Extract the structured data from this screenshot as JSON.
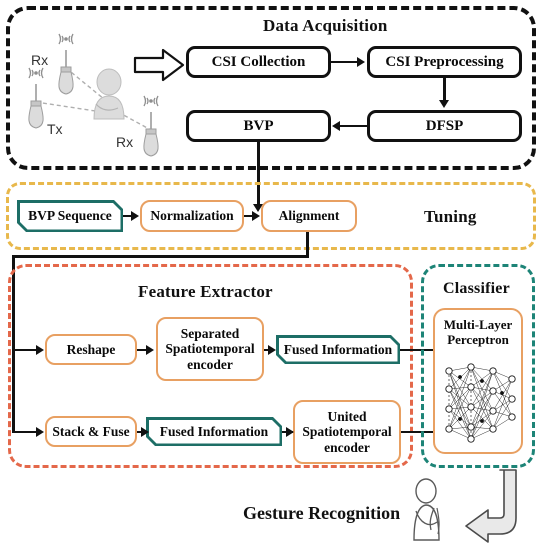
{
  "figure": {
    "caption": "Gesture Recognition",
    "groups": {
      "acquisition": {
        "title": "Data Acquisition",
        "border_color": "#111111",
        "style": "dashed"
      },
      "tuning": {
        "title": "Tuning",
        "border_color": "#E8B84B",
        "style": "dashed"
      },
      "feature": {
        "title": "Feature Extractor",
        "border_color": "#E4684A",
        "style": "dashed"
      },
      "classifier": {
        "title": "Classifier",
        "border_color": "#1D8477",
        "style": "dashed"
      }
    }
  },
  "scene": {
    "labels": {
      "rx_top": "Rx",
      "tx": "Tx",
      "rx_bottom": "Rx"
    },
    "icons": {
      "antenna": "antenna-icon",
      "person": "person-icon",
      "block_arrow": "block-arrow-right-icon"
    }
  },
  "acquisition": {
    "nodes": [
      {
        "id": "csi-collection",
        "label": "CSI Collection"
      },
      {
        "id": "csi-preprocessing",
        "label": "CSI Preprocessing"
      },
      {
        "id": "dfsp",
        "label": "DFSP"
      },
      {
        "id": "bvp",
        "label": "BVP"
      }
    ]
  },
  "tuning": {
    "nodes": [
      {
        "id": "bvp-sequence",
        "label": "BVP Sequence",
        "color": "#1D6E66"
      },
      {
        "id": "normalization",
        "label": "Normalization",
        "color": "#E8A062"
      },
      {
        "id": "alignment",
        "label": "Alignment",
        "color": "#E8A062"
      }
    ]
  },
  "feature_extractor": {
    "nodes": [
      {
        "id": "reshape",
        "label": "Reshape",
        "color": "#E8A062"
      },
      {
        "id": "separated-encoder",
        "label": "Separated Spatiotemporal encoder",
        "color": "#E8A062"
      },
      {
        "id": "fused-information-top",
        "label": "Fused Information",
        "color": "#1D6E66"
      },
      {
        "id": "stack-and-fuse",
        "label": "Stack & Fuse",
        "color": "#E8A062"
      },
      {
        "id": "fused-information-bottom",
        "label": "Fused Information",
        "color": "#1D6E66"
      },
      {
        "id": "united-encoder",
        "label": "United Spatiotemporal encoder",
        "color": "#E8A062"
      }
    ]
  },
  "classifier": {
    "node": {
      "id": "mlp",
      "label": "Multi-Layer Perceptron",
      "color": "#E8A062",
      "diagram": "neural-network-icon"
    }
  },
  "colors": {
    "black": "#111111",
    "gold": "#E8B84B",
    "orange_red": "#E4684A",
    "orange": "#E8A062",
    "teal": "#1D6E66",
    "teal_light": "#1D8477",
    "figure_gray": "#D9D9D9"
  }
}
